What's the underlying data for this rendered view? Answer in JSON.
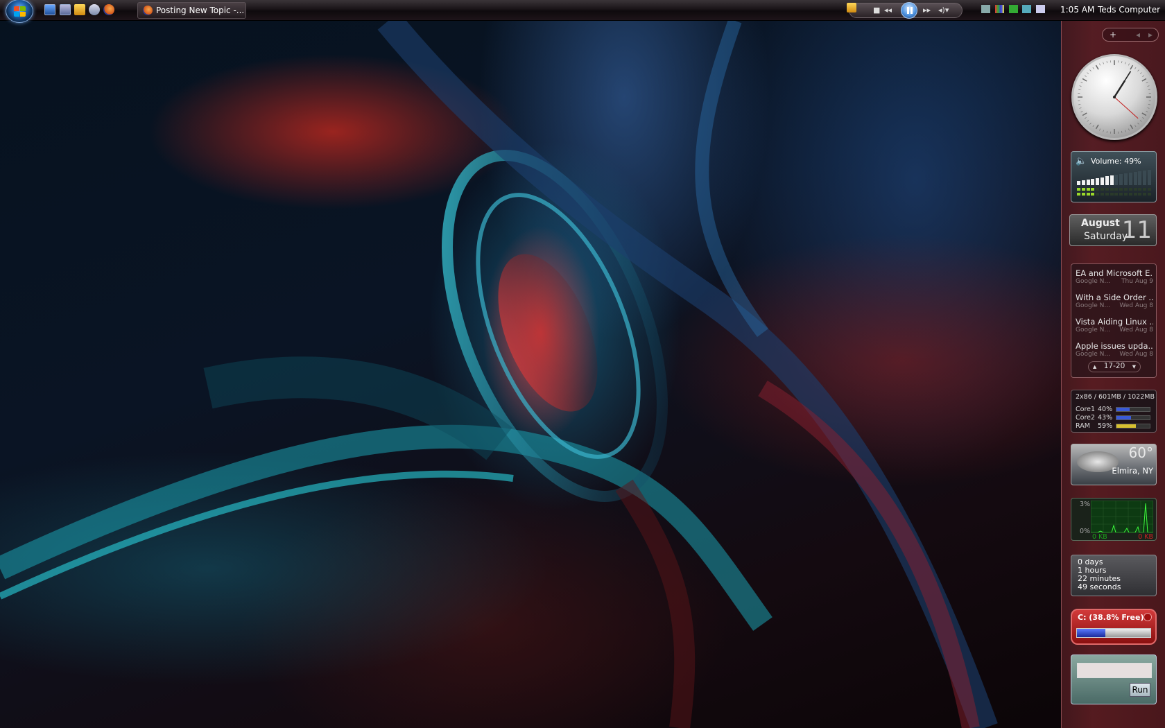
{
  "colors": {
    "taskbar": "#1a1418",
    "sidebar": "#5f1e23",
    "accent_blue": "#4a8fdc",
    "cpu_bar": "#3a5ad8",
    "ram_bar": "#d8c030",
    "network_green": "#1aa31a",
    "drive_red": "#d23a3a"
  },
  "taskbar": {
    "start_icon": "windows-start-orb",
    "quick_launch": [
      "show-desktop-icon",
      "switch-windows-icon",
      "media-player-icon",
      "network-icon",
      "firefox-icon"
    ],
    "task_button_label": "Posting New Topic -...",
    "media_controls": [
      "stop-icon",
      "previous-icon",
      "pause-icon",
      "next-icon",
      "volume-icon"
    ],
    "clock": "1:05 AM",
    "user": "Teds Computer"
  },
  "sidebar": {
    "add_label": "+",
    "clock_gadget": {
      "hour": 1,
      "minute": 5,
      "second": 22
    },
    "volume": {
      "label": "Volume: 49%",
      "level_percent": 49
    },
    "calendar": {
      "month": "August",
      "weekday": "Saturday",
      "day": "11"
    },
    "news": {
      "items": [
        {
          "title": "EA and Microsoft E...",
          "source": "Google N...",
          "date": "Thu Aug 9"
        },
        {
          "title": "With a Side Order ...",
          "source": "Google N...",
          "date": "Wed Aug 8"
        },
        {
          "title": "Vista Aiding Linux ...",
          "source": "Google N...",
          "date": "Wed Aug 8"
        },
        {
          "title": "Apple issues upda...",
          "source": "Google N...",
          "date": "Wed Aug 8"
        }
      ],
      "pager": "17-20"
    },
    "cpu": {
      "header": "2x86 / 601MB / 1022MB",
      "rows": [
        {
          "label": "Core1",
          "value": "40%",
          "fraction": 0.4
        },
        {
          "label": "Core2",
          "value": "43%",
          "fraction": 0.43
        },
        {
          "label": "RAM",
          "value": "59%",
          "fraction": 0.59
        }
      ]
    },
    "weather": {
      "temperature": "60°",
      "location": "Elmira, NY"
    },
    "network": {
      "top_label": "3%",
      "bottom_label": "0%",
      "in_label": "0 KB",
      "out_label": "0 KB"
    },
    "uptime": {
      "days": "0 days",
      "hours": "1 hours",
      "minutes": "22 minutes",
      "seconds": "49 seconds"
    },
    "drive": {
      "label": "C: (38.8% Free)",
      "free_fraction": 0.388
    },
    "run": {
      "input_value": "",
      "button_label": "Run"
    }
  }
}
